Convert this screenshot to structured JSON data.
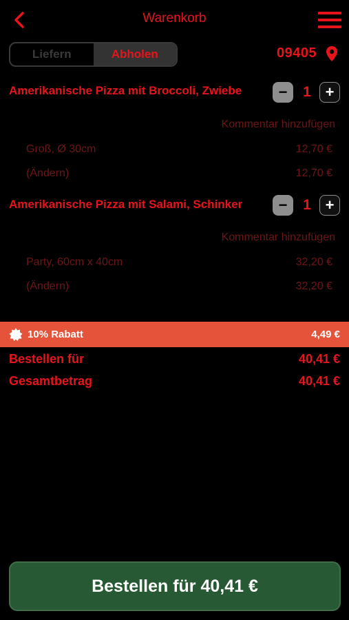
{
  "header": {
    "title": "Warenkorb",
    "back_icon": "chevron-left-icon",
    "menu_icon": "hamburger-menu-icon"
  },
  "mode": {
    "options": [
      "Liefern",
      "Abholen"
    ],
    "selected": "Abholen"
  },
  "postcode": {
    "value": "09405",
    "icon": "map-pin-icon"
  },
  "items": [
    {
      "name": "Amerikanische Pizza mit Broccoli, Zwiebe",
      "quantity": "1",
      "comment_label": "Kommentar hinzufügen",
      "size": "Groß, Ø 30cm",
      "size_price": "12,70 €",
      "change_label": "(Ändern)",
      "change_price": "12,70 €"
    },
    {
      "name": "Amerikanische Pizza mit Salami, Schinker",
      "quantity": "1",
      "comment_label": "Kommentar hinzufügen",
      "size": "Party, 60cm x 40cm",
      "size_price": "32,20 €",
      "change_label": "(Ändern)",
      "change_price": "32,20 €"
    }
  ],
  "discount": {
    "label": "10% Rabatt",
    "value": "4,49 €",
    "icon": "badge-icon"
  },
  "summary": {
    "order_for_label": "Bestellen für",
    "order_for_value": "40,41 €",
    "total_label": "Gesamtbetrag",
    "total_value": "40,41 €"
  },
  "order_button": {
    "label": "Bestellen für 40,41 €"
  },
  "colors": {
    "accent": "#e8141c",
    "discount_bg": "#e5533a",
    "button_bg": "#275a34",
    "muted_text": "#6e1616"
  }
}
